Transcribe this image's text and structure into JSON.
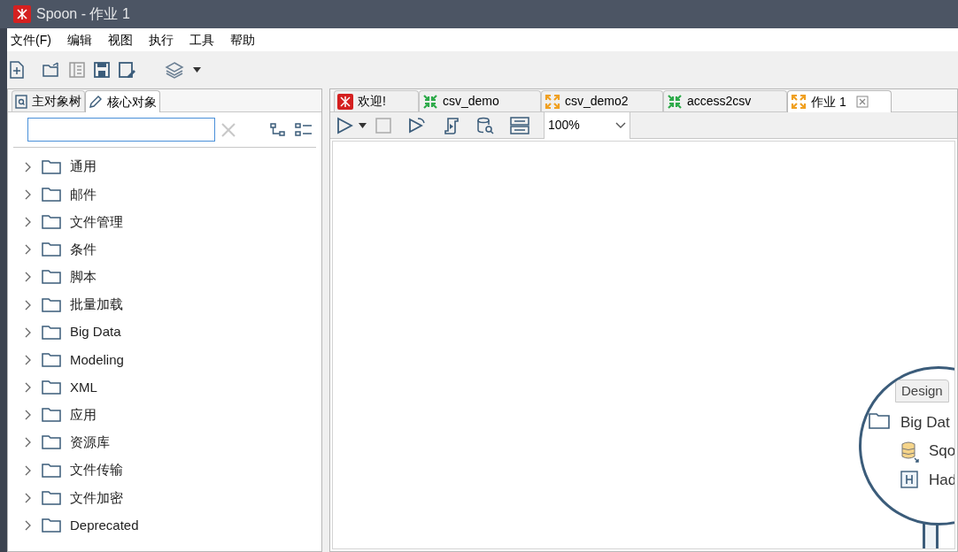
{
  "window": {
    "title": "Spoon - 作业 1"
  },
  "menu": [
    "文件(F)",
    "编辑",
    "视图",
    "执行",
    "工具",
    "帮助"
  ],
  "left_panel": {
    "tabs": [
      {
        "label": "主对象树",
        "kind": "tree",
        "selected": false
      },
      {
        "label": "核心对象",
        "kind": "pencil",
        "selected": true
      }
    ],
    "tree": [
      {
        "label": "通用",
        "expanded": false
      },
      {
        "label": "邮件",
        "expanded": false
      },
      {
        "label": "文件管理",
        "expanded": false
      },
      {
        "label": "条件",
        "expanded": false
      },
      {
        "label": "脚本",
        "expanded": false
      },
      {
        "label": "批量加载",
        "expanded": false
      },
      {
        "label": "Big Data",
        "expanded": false
      },
      {
        "label": "Modeling",
        "expanded": false
      },
      {
        "label": "XML",
        "expanded": false
      },
      {
        "label": "应用",
        "expanded": false
      },
      {
        "label": "资源库",
        "expanded": false
      },
      {
        "label": "文件传输",
        "expanded": false
      },
      {
        "label": "文件加密",
        "expanded": false
      },
      {
        "label": "Deprecated",
        "expanded": false
      }
    ]
  },
  "editor": {
    "tabs": [
      {
        "label": "欢迎!",
        "kind": "welcome",
        "selected": false
      },
      {
        "label": "csv_demo",
        "kind": "transformation",
        "selected": false
      },
      {
        "label": "csv_demo2",
        "kind": "job",
        "selected": false
      },
      {
        "label": "access2csv",
        "kind": "transformation",
        "selected": false
      },
      {
        "label": "作业 1",
        "kind": "job",
        "selected": true
      }
    ],
    "zoom": "100%",
    "canvas_graphic": {
      "tab": "Design",
      "items": [
        {
          "kind": "folder",
          "label": "Big Dat"
        },
        {
          "kind": "database",
          "label": "Sqo"
        },
        {
          "kind": "hadoop",
          "label": "Had"
        }
      ]
    }
  }
}
